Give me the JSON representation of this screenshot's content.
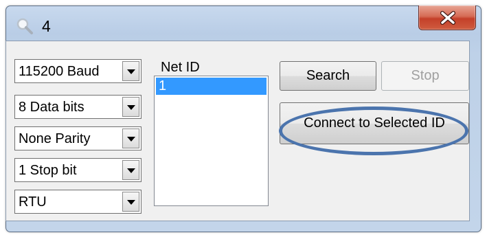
{
  "window": {
    "title": "4",
    "icon": "magnifier-icon",
    "close_icon": "close-icon"
  },
  "settings": {
    "baud": "115200 Baud",
    "data_bits": "8 Data bits",
    "parity": "None Parity",
    "stop_bits": "1 Stop bit",
    "mode": "RTU"
  },
  "net_id": {
    "label": "Net ID",
    "items": [
      "1"
    ],
    "selected_index": 0
  },
  "buttons": {
    "search": "Search",
    "stop": "Stop",
    "connect": "Connect to Selected ID"
  },
  "colors": {
    "selection": "#3399ff",
    "highlight_ring": "#4b74ad",
    "close_button": "#c4402a"
  }
}
